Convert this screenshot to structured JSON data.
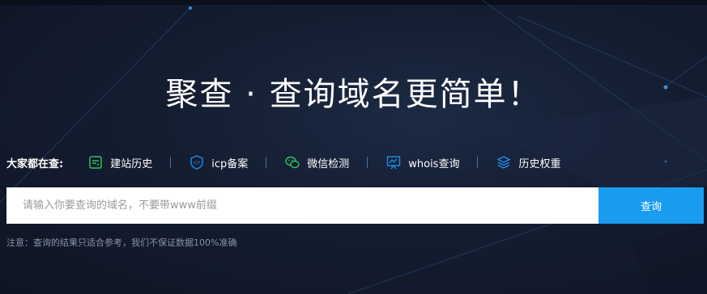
{
  "headline": "聚查 · 查询域名更简单！",
  "hot": {
    "label": "大家都在查:",
    "items": [
      {
        "label": "建站历史",
        "icon": "history-doc-icon",
        "color": "#2fc05a"
      },
      {
        "label": "icp备案",
        "icon": "icp-shield-icon",
        "color": "#1a8fe8"
      },
      {
        "label": "微信检测",
        "icon": "wechat-icon",
        "color": "#2fc05a"
      },
      {
        "label": "whois查询",
        "icon": "whois-board-icon",
        "color": "#1a8fe8"
      },
      {
        "label": "历史权重",
        "icon": "layers-icon",
        "color": "#1a8fe8"
      }
    ]
  },
  "search": {
    "placeholder": "请输入你要查询的域名，不要带www前缀",
    "button_label": "查询"
  },
  "note": "注意：查询的结果只适合参考，我们不保证数据100%准确",
  "colors": {
    "accent": "#1a9cf0",
    "background": "#141d30"
  }
}
